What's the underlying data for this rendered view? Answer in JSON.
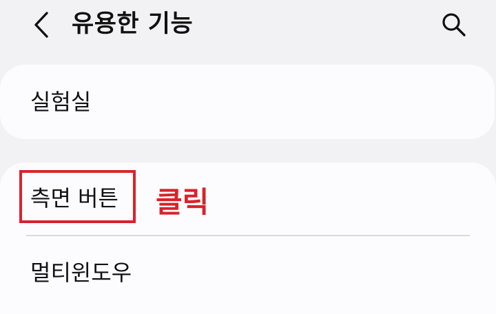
{
  "header": {
    "title": "유용한 기능",
    "back_icon": "chevron-left-icon",
    "search_icon": "search-icon"
  },
  "items": {
    "lab": "실험실",
    "side_button": "측면 버튼",
    "multi_window": "멀티윈도우"
  },
  "annotation": {
    "text": "클릭",
    "color": "#d9222a"
  }
}
